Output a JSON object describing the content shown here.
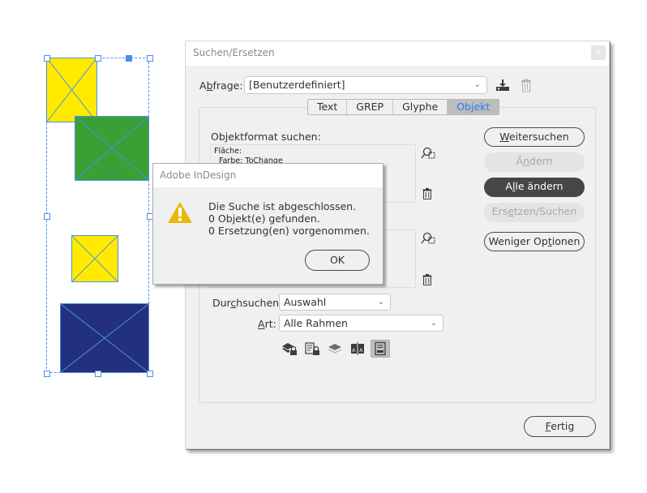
{
  "canvas": {
    "frames": [
      {
        "name": "yellow-frame-top",
        "color": "#ffea00"
      },
      {
        "name": "green-frame",
        "color": "#3aa035"
      },
      {
        "name": "yellow-frame-small",
        "color": "#ffea00"
      },
      {
        "name": "blue-frame",
        "color": "#22307e"
      }
    ],
    "selection_color": "#4a90e8"
  },
  "dialog": {
    "title": "Suchen/Ersetzen",
    "close_label": "x",
    "query": {
      "label_pre": "A",
      "label_u": "b",
      "label_post": "frage:",
      "value": "[Benutzerdefiniert]",
      "save_icon": "save-query-icon",
      "delete_icon": "delete-query-icon"
    },
    "tabs": [
      {
        "label": "Text",
        "active": false
      },
      {
        "label": "GREP",
        "active": false
      },
      {
        "label": "Glyphe",
        "active": false
      },
      {
        "label": "Objekt",
        "active": true
      }
    ],
    "find_format": {
      "label": "Objektformat suchen:",
      "lines": [
        "Fläche:",
        "  Farbe: ToChange"
      ]
    },
    "change_format": {
      "lines": []
    },
    "buttons": {
      "find_next": {
        "pre": "",
        "u": "W",
        "post": "eitersuchen"
      },
      "change": {
        "pre": "Ä",
        "u": "n",
        "post": "dern"
      },
      "change_all": {
        "pre": "A",
        "u": "l",
        "post": "le ändern"
      },
      "change_find": {
        "pre": "Ers",
        "u": "e",
        "post": "tzen/Suchen"
      },
      "fewer_options": {
        "pre": "Weniger Op",
        "u": "t",
        "post": "ionen"
      },
      "done": {
        "pre": "",
        "u": "F",
        "post": "ertig"
      }
    },
    "search_in": {
      "label_pre": "Dur",
      "label_u": "c",
      "label_post": "hsuchen:",
      "value": "Auswahl"
    },
    "type": {
      "label_pre": "",
      "label_u": "A",
      "label_post": "rt:",
      "value": "Alle Rahmen"
    },
    "option_icons": [
      {
        "name": "include-locked-layers-icon",
        "active": false
      },
      {
        "name": "include-locked-objects-icon",
        "active": false
      },
      {
        "name": "include-hidden-layers-icon",
        "active": false
      },
      {
        "name": "include-master-pages-icon",
        "active": false
      },
      {
        "name": "include-footnotes-icon",
        "active": true
      }
    ]
  },
  "alert": {
    "title": "Adobe InDesign",
    "icon": "warning-icon",
    "lines": [
      "Die Suche ist abgeschlossen.",
      "0 Objekt(e) gefunden.",
      "0 Ersetzung(en) vorgenommen."
    ],
    "ok_label": "OK"
  }
}
